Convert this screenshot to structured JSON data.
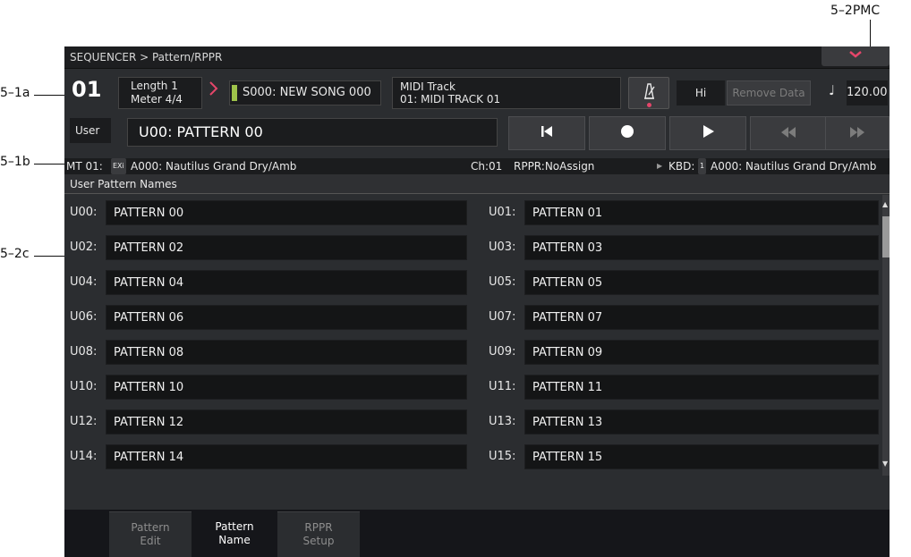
{
  "callouts": {
    "pmc": "5–2PMC",
    "a1": "5–1a",
    "b1": "5–1b",
    "c2": "5–2c"
  },
  "titlebar": {
    "breadcrumb": "SEQUENCER > Pattern/RPPR"
  },
  "song": {
    "number": "01",
    "length": "Length 1",
    "meter": "Meter 4/4",
    "song_name": "S000: NEW SONG 000",
    "track_title": "MIDI Track",
    "track_name": "01: MIDI TRACK 01",
    "hi": "Hi",
    "remove_data": "Remove Data",
    "note_glyph": "♩",
    "tempo": "120.00"
  },
  "pattern": {
    "bank": "User",
    "current": "U00: PATTERN 00"
  },
  "transport_icons": [
    "rewind-to-start-icon",
    "record-icon",
    "play-icon",
    "rewind-icon",
    "fast-forward-icon"
  ],
  "infobar": {
    "track": "MT 01:",
    "exi": "EXi",
    "program": "A000: Nautilus Grand Dry/Amb",
    "channel": "Ch:01",
    "rppr": "RPPR:NoAssign",
    "kbd": "KBD:",
    "kbd_num": "1",
    "kbd_program": "A000: Nautilus Grand Dry/Amb"
  },
  "section_title": "User Pattern Names",
  "patterns": [
    {
      "id": "U00:",
      "name": "PATTERN 00"
    },
    {
      "id": "U01:",
      "name": "PATTERN 01"
    },
    {
      "id": "U02:",
      "name": "PATTERN 02"
    },
    {
      "id": "U03:",
      "name": "PATTERN 03"
    },
    {
      "id": "U04:",
      "name": "PATTERN 04"
    },
    {
      "id": "U05:",
      "name": "PATTERN 05"
    },
    {
      "id": "U06:",
      "name": "PATTERN 06"
    },
    {
      "id": "U07:",
      "name": "PATTERN 07"
    },
    {
      "id": "U08:",
      "name": "PATTERN 08"
    },
    {
      "id": "U09:",
      "name": "PATTERN 09"
    },
    {
      "id": "U10:",
      "name": "PATTERN 10"
    },
    {
      "id": "U11:",
      "name": "PATTERN 11"
    },
    {
      "id": "U12:",
      "name": "PATTERN 12"
    },
    {
      "id": "U13:",
      "name": "PATTERN 13"
    },
    {
      "id": "U14:",
      "name": "PATTERN 14"
    },
    {
      "id": "U15:",
      "name": "PATTERN 15"
    }
  ],
  "tabs": [
    {
      "line1": "Pattern",
      "line2": "Edit",
      "active": false
    },
    {
      "line1": "Pattern",
      "line2": "Name",
      "active": true
    },
    {
      "line1": "RPPR",
      "line2": "Setup",
      "active": false
    }
  ],
  "colors": {
    "accent": "#e5466a",
    "track_green": "#9ec34a",
    "background": "#2b2d30"
  }
}
